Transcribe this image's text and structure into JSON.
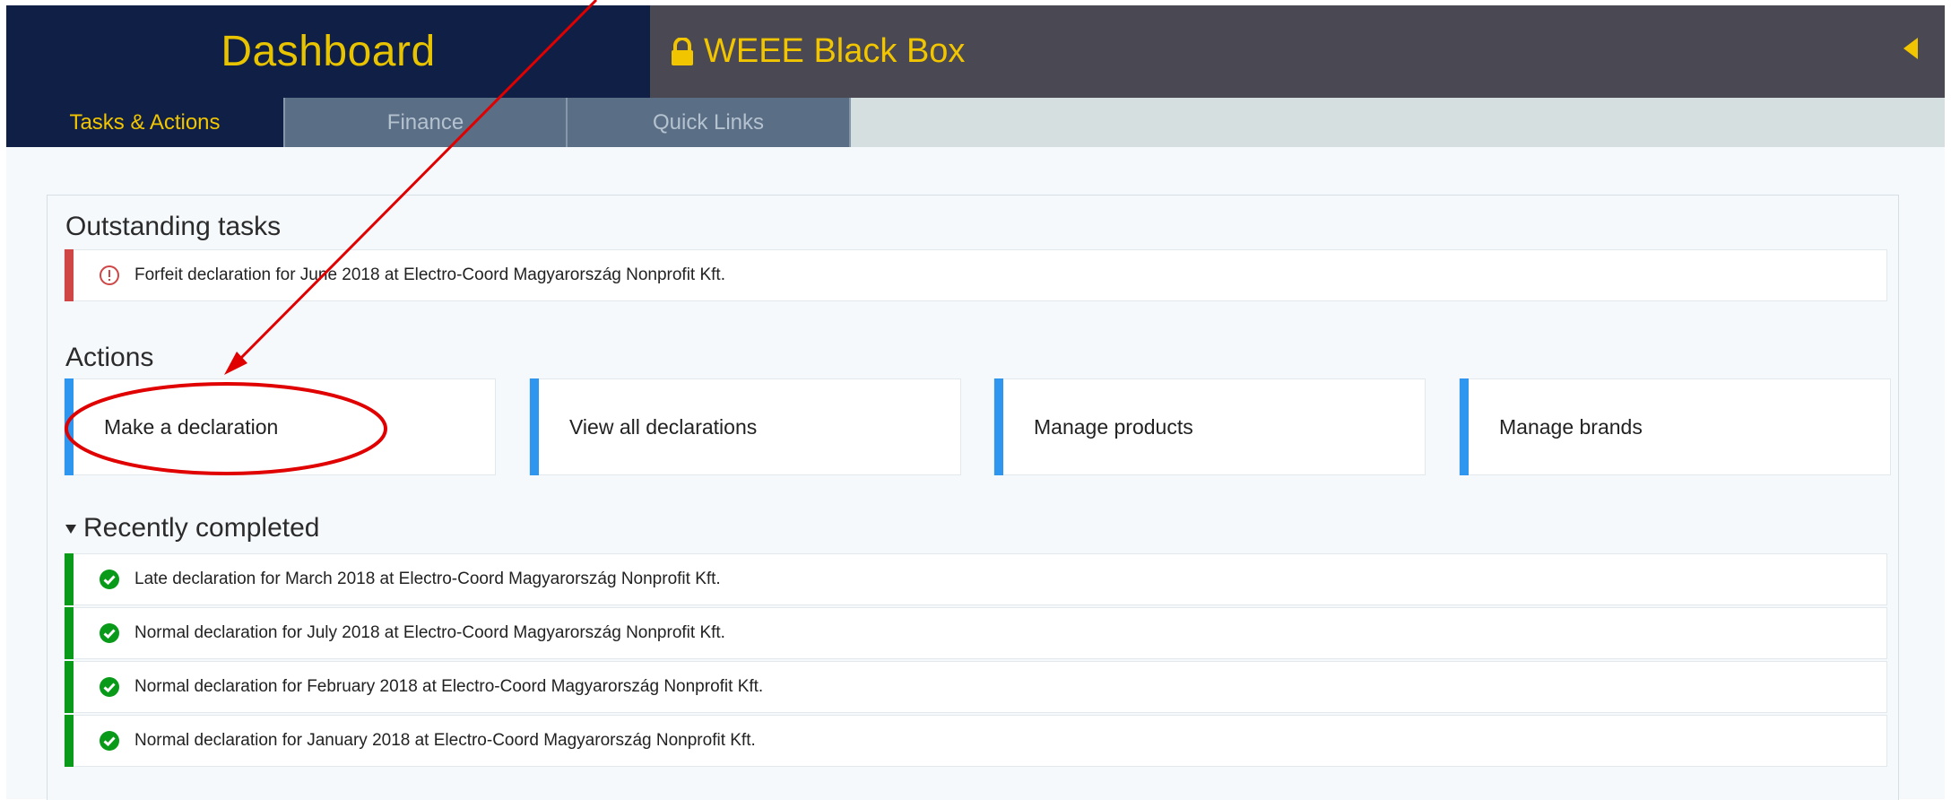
{
  "header": {
    "title": "Dashboard",
    "brand": "WEEE Black Box",
    "brand_icon": "lock-icon",
    "collapse_icon": "caret-left-icon"
  },
  "tabs": [
    {
      "label": "Tasks & Actions",
      "active": true
    },
    {
      "label": "Finance",
      "active": false
    },
    {
      "label": "Quick Links",
      "active": false
    }
  ],
  "outstanding": {
    "title": "Outstanding tasks",
    "items": [
      {
        "text": "Forfeit declaration for June 2018 at Electro-Coord Magyarország Nonprofit Kft.",
        "icon": "warning-circle-icon"
      }
    ]
  },
  "actions": {
    "title": "Actions",
    "items": [
      {
        "label": "Make a declaration"
      },
      {
        "label": "View all declarations"
      },
      {
        "label": "Manage products"
      },
      {
        "label": "Manage brands"
      }
    ]
  },
  "recent": {
    "title": "Recently completed",
    "items": [
      {
        "text": "Late declaration for March 2018 at Electro-Coord Magyarország Nonprofit Kft.",
        "icon": "check-circle-icon"
      },
      {
        "text": "Normal declaration for July 2018 at Electro-Coord Magyarország Nonprofit Kft.",
        "icon": "check-circle-icon"
      },
      {
        "text": "Normal declaration for February 2018 at Electro-Coord Magyarország Nonprofit Kft.",
        "icon": "check-circle-icon"
      },
      {
        "text": "Normal declaration for January 2018 at Electro-Coord Magyarország Nonprofit Kft.",
        "icon": "check-circle-icon"
      }
    ]
  },
  "colors": {
    "header_dark": "#0f1f45",
    "brand_bar": "#4a4852",
    "accent_yellow": "#f1c500",
    "action_blue": "#2f96ef",
    "error_red": "#d04545",
    "success_green": "#0a9a1a",
    "annotation_red": "#e00000"
  }
}
